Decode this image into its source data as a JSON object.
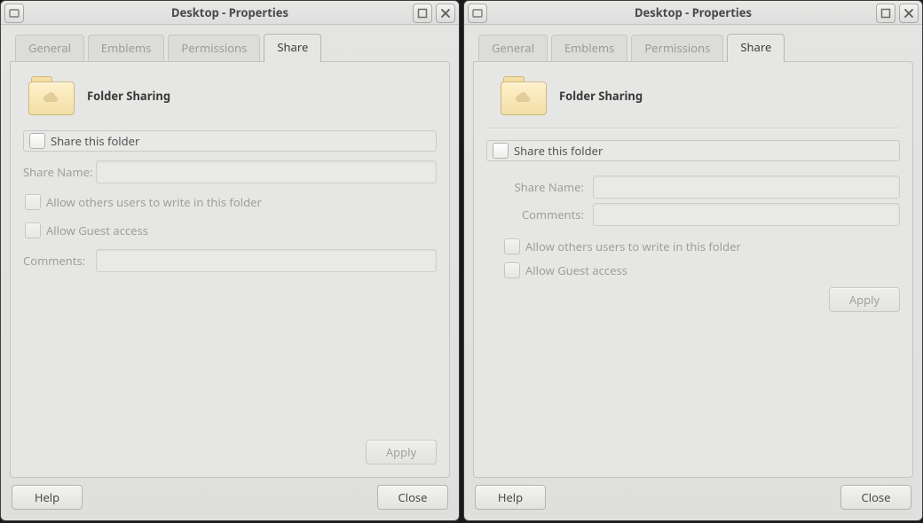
{
  "title": "Desktop - Properties",
  "tabs": {
    "general": "General",
    "emblems": "Emblems",
    "permissions": "Permissions",
    "share": "Share"
  },
  "share": {
    "heading": "Folder Sharing",
    "share_this_folder": "Share this folder",
    "share_name_label": "Share Name:",
    "share_name_value": "",
    "allow_write": "Allow others users to write in this folder",
    "allow_guest": "Allow Guest access",
    "comments_label": "Comments:",
    "comments_value": "",
    "apply": "Apply"
  },
  "footer": {
    "help": "Help",
    "close": "Close"
  }
}
